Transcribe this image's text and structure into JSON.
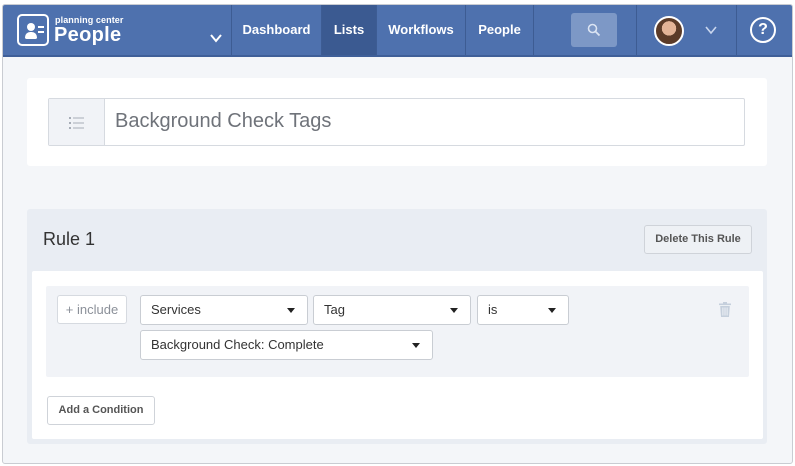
{
  "brand": {
    "small_text": "planning center",
    "big_text": "People",
    "icon": "people-logo-icon"
  },
  "nav": {
    "items": [
      {
        "label": "Dashboard",
        "active": false
      },
      {
        "label": "Lists",
        "active": true
      },
      {
        "label": "Workflows",
        "active": false
      },
      {
        "label": "People",
        "active": false
      }
    ],
    "search_icon": "search-icon",
    "help_label": "?"
  },
  "list": {
    "title": "Background Check Tags",
    "icon": "list-icon"
  },
  "rule": {
    "title": "Rule 1",
    "delete_label": "Delete This Rule",
    "condition": {
      "include_label": "+ include",
      "source": "Services",
      "field": "Tag",
      "operator": "is",
      "value": "Background Check: Complete"
    },
    "add_condition_label": "Add a Condition"
  },
  "colors": {
    "nav_bg": "#4e71ae",
    "nav_active": "#3b5a91",
    "page_bg": "#f4f6f9"
  }
}
